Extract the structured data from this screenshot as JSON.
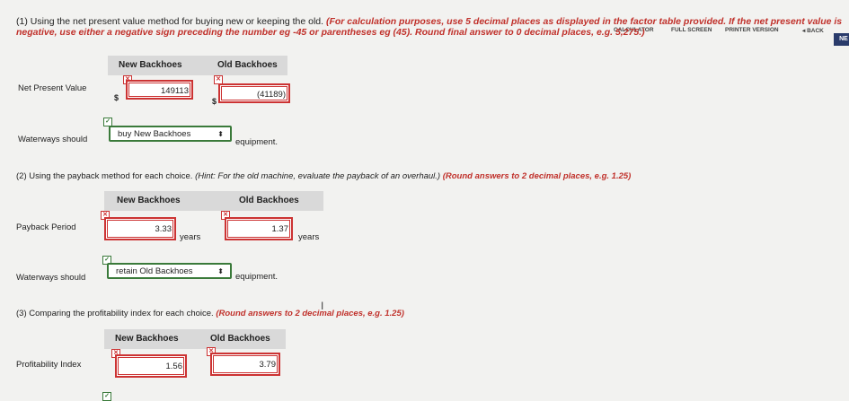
{
  "toolbar": {
    "calculator": "CALCULATOR",
    "full_screen": "FULL SCREEN",
    "printer_version": "PRINTER VERSION",
    "back": "◂ BACK",
    "next": "NE"
  },
  "q1": {
    "prefix": "(1) Using the net present value method for buying new or keeping the old. ",
    "instructions": "(For calculation purposes, use 5 decimal places as displayed in the factor table provided. If the net present value is negative, use either a negative sign preceding the number eg -45 or parentheses eg (45). Round final answer to 0 decimal places, e.g. 5,275.)",
    "col_new": "New Backhoes",
    "col_old": "Old Backhoes",
    "row_label": "Net Present Value",
    "new_value": "149113",
    "old_value": "(41189)",
    "currency": "$",
    "should_label": "Waterways should",
    "select_value": "buy New Backhoes",
    "after_label": "equipment."
  },
  "q2": {
    "prefix": "(2) Using the payback method for each choice. ",
    "hint": "(Hint: For the old machine, evaluate the payback of an overhaul.)",
    "instructions": "(Round answers to 2 decimal places, e.g. 1.25)",
    "col_new": "New Backhoes",
    "col_old": "Old Backhoes",
    "row_label": "Payback Period",
    "new_value": "3.33",
    "old_value": "1.37",
    "unit": "years",
    "should_label": "Waterways should",
    "select_value": "retain Old Backhoes",
    "after_label": "equipment."
  },
  "q3": {
    "prefix": "(3) Comparing the profitability index for each choice. ",
    "instructions": "(Round answers to 2 decimal places, e.g. 1.25)",
    "col_new": "New Backhoes",
    "col_old": "Old Backhoes",
    "row_label": "Profitability Index",
    "new_value": "1.56",
    "old_value": "3.79"
  },
  "icons": {
    "error": "✕",
    "correct": "✓",
    "select_arrow": "⬍"
  }
}
